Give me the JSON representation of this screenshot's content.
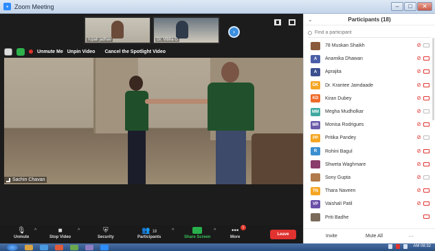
{
  "window": {
    "title": "Zoom Meeting",
    "controls": [
      "–",
      "□",
      "✕"
    ]
  },
  "thumbnails": [
    {
      "name": "rupali jadhav"
    },
    {
      "name": "Dr. Vibha G"
    }
  ],
  "spotlight": {
    "unmute_label": "Unmute Me",
    "unpin_label": "Unpin Video",
    "cancel_label": "Cancel the Spotlight Video"
  },
  "main_video": {
    "speaker": "Sachin Chavan"
  },
  "toolbar": {
    "unmute": "Unmute",
    "stop_video": "Stop Video",
    "security": "Security",
    "participants": "Participants",
    "participants_count": "18",
    "share_screen": "Share Screen",
    "more": "More",
    "more_badge": "1",
    "leave": "Leave"
  },
  "panel": {
    "title": "Participants (18)",
    "search_placeholder": "Find a participant",
    "participants": [
      {
        "name": "78 Muskan Shaikh",
        "initials": "",
        "color": "#8a5a3c",
        "muted": true,
        "video": "off"
      },
      {
        "name": "Anamika Dhawan",
        "initials": "A",
        "color": "#4a5fa8",
        "muted": true,
        "video": "red"
      },
      {
        "name": "Aprajita",
        "initials": "A",
        "color": "#3b4f8f",
        "muted": true,
        "video": "red"
      },
      {
        "name": "Dr. Krantee Jamdaade",
        "initials": "DK",
        "color": "#f5a623",
        "muted": true,
        "video": "red"
      },
      {
        "name": "Kiran Dubey",
        "initials": "KD",
        "color": "#f06a2a",
        "muted": true,
        "video": "red"
      },
      {
        "name": "Megha Mudholkar",
        "initials": "MM",
        "color": "#3fa9a0",
        "muted": true,
        "video": "off"
      },
      {
        "name": "Monisa Rodrigues",
        "initials": "MR",
        "color": "#6a5aa8",
        "muted": true,
        "video": "red"
      },
      {
        "name": "Pritika Pandey",
        "initials": "PP",
        "color": "#f5a623",
        "muted": true,
        "video": "off"
      },
      {
        "name": "Rohini Bagul",
        "initials": "R",
        "color": "#3b8fd0",
        "muted": true,
        "video": "red"
      },
      {
        "name": "Shweta Waghmare",
        "initials": "",
        "color": "#8a3c6a",
        "muted": true,
        "video": "red"
      },
      {
        "name": "Sony Gupta",
        "initials": "",
        "color": "#b07a4a",
        "muted": true,
        "video": "off"
      },
      {
        "name": "Thara Naveen",
        "initials": "TN",
        "color": "#f5a623",
        "muted": true,
        "video": "red"
      },
      {
        "name": "Vaishali Patil",
        "initials": "VP",
        "color": "#6a4fa8",
        "muted": true,
        "video": "red"
      },
      {
        "name": "Priti Badhe",
        "initials": "",
        "color": "#7a6a5a",
        "muted": false,
        "video": "red"
      }
    ],
    "invite": "Invite",
    "mute_all": "Mute All",
    "more": "..."
  },
  "taskbar": {
    "clock": "AM 08:32"
  }
}
